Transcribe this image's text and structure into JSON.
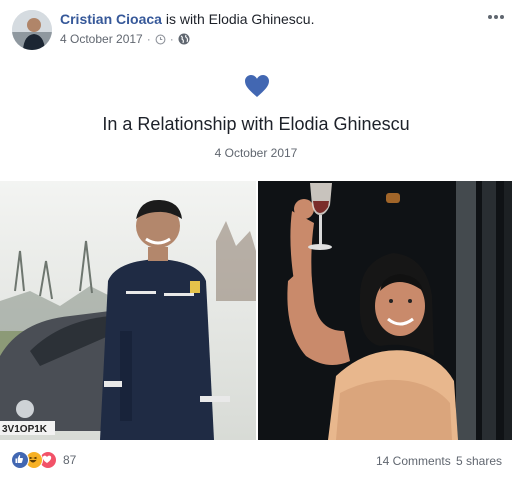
{
  "post": {
    "author": "Cristian Cioaca",
    "with_text": " is with ",
    "tagged": "Elodia Ghinescu.",
    "date": "4 October 2017",
    "separator": "·",
    "icons": [
      "clock-icon",
      "globe-icon",
      "more-options-icon"
    ]
  },
  "life_event": {
    "icon": "heart-icon",
    "title": "In a Relationship with Elodia Ghinescu",
    "date": "4 October 2017",
    "heart_color": "#4267b2"
  },
  "photos": {
    "left_plate_text": "3V1OP1K"
  },
  "footer": {
    "reaction_icons": [
      "like-reaction-icon",
      "haha-reaction-icon",
      "love-reaction-icon"
    ],
    "reaction_count": "87",
    "comments": "14 Comments",
    "shares": "5 shares"
  },
  "colors": {
    "link": "#365899",
    "meta": "#616770",
    "like": "#4267b2",
    "haha": "#f7b125",
    "love": "#f25268"
  }
}
